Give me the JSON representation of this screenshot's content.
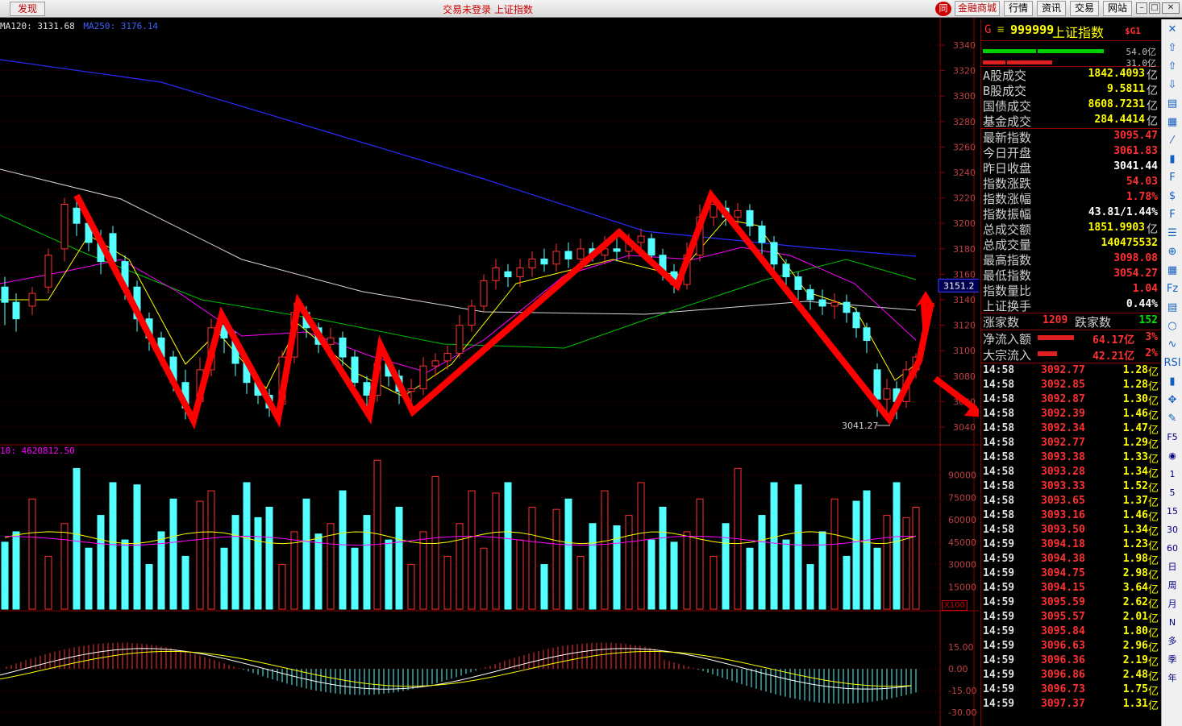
{
  "titlebar": {
    "discover": "发现",
    "title": "交易未登录  上证指数",
    "logo_icon": "同",
    "buttons": [
      "金融商城",
      "行情",
      "资讯",
      "交易",
      "网站"
    ]
  },
  "chart": {
    "ma_legend": [
      {
        "text": "MA120: 3131.68",
        "color": "#e0e0e0"
      },
      {
        "text": "MA250: 3176.14",
        "color": "#4060ff"
      }
    ],
    "vol_legend": "10: 4620812.50",
    "x100": "X100",
    "price_label": "3151.2",
    "low_label": "3041.27",
    "price_ticks": [
      "3340",
      "3320",
      "3300",
      "3280",
      "3260",
      "3240",
      "3220",
      "3200",
      "3180",
      "3160",
      "3140",
      "3120",
      "3100",
      "3080",
      "3060",
      "3040"
    ],
    "vol_ticks": [
      "90000",
      "75000",
      "60000",
      "45000",
      "30000",
      "15000"
    ],
    "macd_ticks": [
      "15.00",
      "0.00",
      "-15.00",
      "-30.00"
    ],
    "colors": {
      "up": "#ff3030",
      "down": "#54ffff",
      "ma250": "#2a2aff",
      "ma120": "#d8d8d8",
      "ma60": "#00c000",
      "ma30": "#ff00ff",
      "ma10": "#ffff00",
      "ma5": "#ffffff",
      "arrow": "#ff0000"
    }
  },
  "chart_data": {
    "type": "candlestick",
    "title": "上证指数",
    "y_range": [
      3030,
      3345
    ],
    "last_price": 3095.47,
    "low": 3041.27,
    "zigzag_overlay": [
      3222,
      3045,
      3128,
      3047,
      3138,
      3049,
      3104,
      3052,
      3193,
      3151,
      3222,
      3046,
      3092,
      3138
    ],
    "ma250_endpoints": [
      3330,
      3176.14
    ],
    "ma120_endpoints": [
      3245,
      3131.68
    ],
    "volume_avg": 4620812.5
  },
  "panel": {
    "g": "G",
    "eq": "≡",
    "code": "999999",
    "name": "上证指数",
    "sg": "$G1",
    "bar_green_label": "54.0亿",
    "bar_red_label": "31.0亿",
    "volumes": [
      {
        "k": "A股成交",
        "v": "1842.4093",
        "u": "亿"
      },
      {
        "k": "B股成交",
        "v": "9.5811",
        "u": "亿"
      },
      {
        "k": "国债成交",
        "v": "8608.7231",
        "u": "亿"
      },
      {
        "k": "基金成交",
        "v": "284.4414",
        "u": "亿"
      }
    ],
    "stats": [
      {
        "k": "最新指数",
        "v": "3095.47",
        "c": "red"
      },
      {
        "k": "今日开盘",
        "v": "3061.83",
        "c": "red"
      },
      {
        "k": "昨日收盘",
        "v": "3041.44",
        "c": "wht"
      },
      {
        "k": "指数涨跌",
        "v": "54.03",
        "c": "red"
      },
      {
        "k": "指数涨幅",
        "v": "1.78%",
        "c": "red"
      },
      {
        "k": "指数振幅",
        "v": "43.81/1.44%",
        "c": "wht"
      },
      {
        "k": "总成交额",
        "v": "1851.9903",
        "u": "亿",
        "c": "yel"
      },
      {
        "k": "总成交量",
        "v": "140475532",
        "c": "yel"
      },
      {
        "k": "最高指数",
        "v": "3098.08",
        "c": "red"
      },
      {
        "k": "最低指数",
        "v": "3054.27",
        "c": "red"
      },
      {
        "k": "指数量比",
        "v": "1.04",
        "c": "red"
      },
      {
        "k": "上证换手",
        "v": "0.44%",
        "c": "wht"
      }
    ],
    "up_label": "涨家数",
    "up_count": "1209",
    "down_label": "跌家数",
    "down_count": "152",
    "flows": [
      {
        "k": "净流入额",
        "v": "64.17亿",
        "p": "3%",
        "fill": 0.62
      },
      {
        "k": "大宗流入",
        "v": "42.21亿",
        "p": "2%",
        "fill": 0.34
      }
    ],
    "ticks": [
      {
        "t": "14:58",
        "p": "3092.77",
        "v": "1.28"
      },
      {
        "t": "14:58",
        "p": "3092.85",
        "v": "1.28"
      },
      {
        "t": "14:58",
        "p": "3092.87",
        "v": "1.30"
      },
      {
        "t": "14:58",
        "p": "3092.39",
        "v": "1.46"
      },
      {
        "t": "14:58",
        "p": "3092.34",
        "v": "1.47"
      },
      {
        "t": "14:58",
        "p": "3092.77",
        "v": "1.29"
      },
      {
        "t": "14:58",
        "p": "3093.38",
        "v": "1.33"
      },
      {
        "t": "14:58",
        "p": "3093.28",
        "v": "1.34"
      },
      {
        "t": "14:58",
        "p": "3093.33",
        "v": "1.52"
      },
      {
        "t": "14:58",
        "p": "3093.65",
        "v": "1.37"
      },
      {
        "t": "14:58",
        "p": "3093.16",
        "v": "1.46"
      },
      {
        "t": "14:58",
        "p": "3093.50",
        "v": "1.34"
      },
      {
        "t": "14:59",
        "p": "3094.18",
        "v": "1.23"
      },
      {
        "t": "14:59",
        "p": "3094.38",
        "v": "1.98"
      },
      {
        "t": "14:59",
        "p": "3094.75",
        "v": "2.98"
      },
      {
        "t": "14:59",
        "p": "3094.15",
        "v": "3.64"
      },
      {
        "t": "14:59",
        "p": "3095.59",
        "v": "2.62"
      },
      {
        "t": "14:59",
        "p": "3095.57",
        "v": "2.01"
      },
      {
        "t": "14:59",
        "p": "3095.84",
        "v": "1.80"
      },
      {
        "t": "14:59",
        "p": "3096.63",
        "v": "2.96"
      },
      {
        "t": "14:59",
        "p": "3096.36",
        "v": "2.19"
      },
      {
        "t": "14:59",
        "p": "3096.86",
        "v": "2.48"
      },
      {
        "t": "14:59",
        "p": "3096.73",
        "v": "1.75"
      },
      {
        "t": "14:59",
        "p": "3097.37",
        "v": "1.31"
      }
    ],
    "tick_unit": "亿"
  },
  "toolbar": {
    "icons": [
      "close-icon",
      "up-arrow-icon",
      "up-icon",
      "down-icon",
      "report-icon",
      "grid-icon",
      "line-icon",
      "candle-icon",
      "f10-icon",
      "money-icon",
      "f10b-icon",
      "index-icon",
      "zoom-icon",
      "note-icon",
      "fiz-icon",
      "list-icon",
      "circle-icon",
      "wave-icon",
      "rsi-icon",
      "bars-icon",
      "move-icon",
      "pen-icon"
    ],
    "icon_glyphs": [
      "✕",
      "⇧",
      "⇧",
      "⇩",
      "▤",
      "▦",
      "⁄",
      "▮",
      "F",
      "$",
      "F",
      "☰",
      "⊕",
      "▦",
      "Fz",
      "▤",
      "○",
      "∿",
      "RSI",
      "▮",
      "✥",
      "✎"
    ],
    "periods": [
      "F5",
      "◉",
      "1",
      "5",
      "15",
      "30",
      "60",
      "日",
      "周",
      "月",
      "N",
      "多",
      "季",
      "年"
    ]
  }
}
